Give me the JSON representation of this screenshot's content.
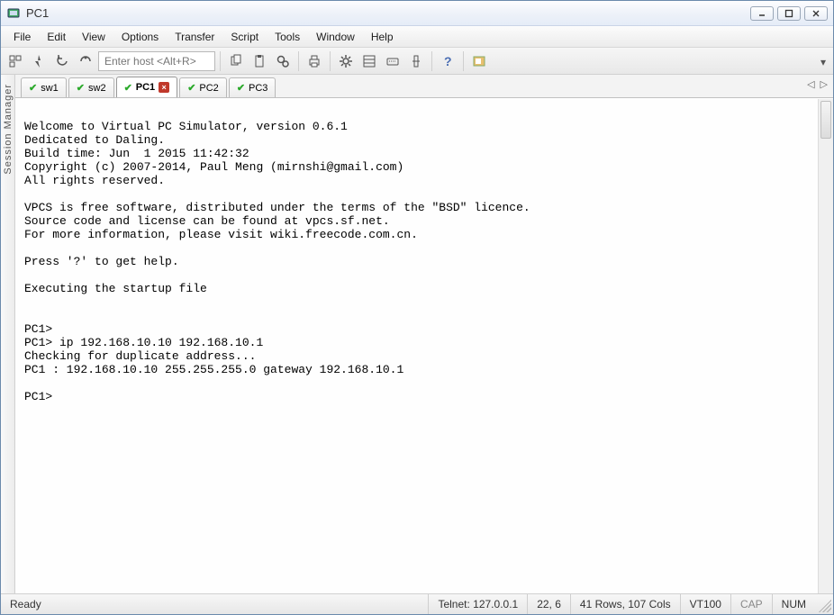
{
  "window": {
    "title": "PC1"
  },
  "menu": {
    "file": "File",
    "edit": "Edit",
    "view": "View",
    "options": "Options",
    "transfer": "Transfer",
    "script": "Script",
    "tools": "Tools",
    "window": "Window",
    "help": "Help"
  },
  "toolbar": {
    "host_placeholder": "Enter host <Alt+R>"
  },
  "sidebar": {
    "label": "Session Manager"
  },
  "tabs": [
    {
      "label": "sw1",
      "active": false
    },
    {
      "label": "sw2",
      "active": false
    },
    {
      "label": "PC1",
      "active": true
    },
    {
      "label": "PC2",
      "active": false
    },
    {
      "label": "PC3",
      "active": false
    }
  ],
  "terminal": {
    "lines": [
      "",
      "Welcome to Virtual PC Simulator, version 0.6.1",
      "Dedicated to Daling.",
      "Build time: Jun  1 2015 11:42:32",
      "Copyright (c) 2007-2014, Paul Meng (mirnshi@gmail.com)",
      "All rights reserved.",
      "",
      "VPCS is free software, distributed under the terms of the \"BSD\" licence.",
      "Source code and license can be found at vpcs.sf.net.",
      "For more information, please visit wiki.freecode.com.cn.",
      "",
      "Press '?' to get help.",
      "",
      "Executing the startup file",
      "",
      "",
      "PC1>",
      "PC1> ip 192.168.10.10 192.168.10.1",
      "Checking for duplicate address...",
      "PC1 : 192.168.10.10 255.255.255.0 gateway 192.168.10.1",
      "",
      "PC1>"
    ]
  },
  "status": {
    "ready": "Ready",
    "conn": "Telnet: 127.0.0.1",
    "cursor": "22,   6",
    "size": "41 Rows, 107 Cols",
    "emul": "VT100",
    "caps": "CAP",
    "num": "NUM"
  }
}
